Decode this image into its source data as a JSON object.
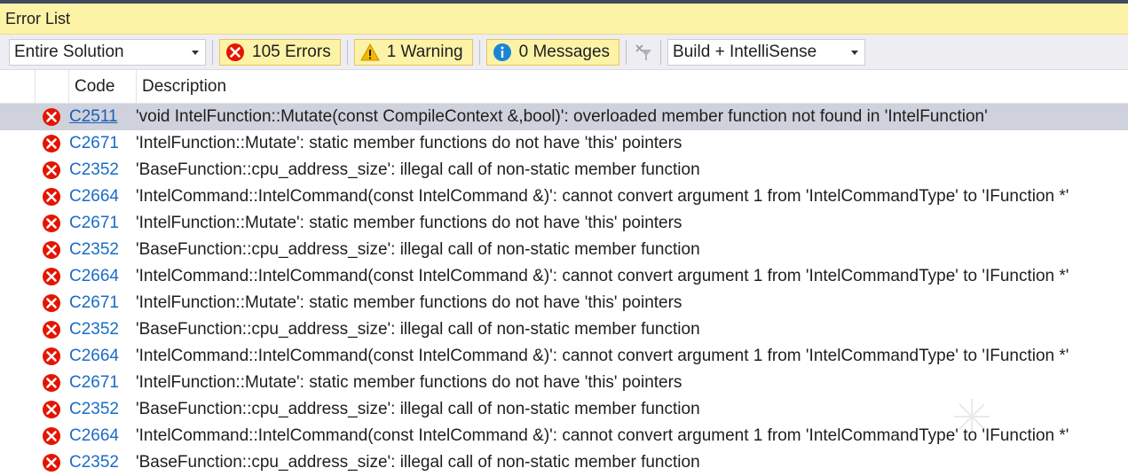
{
  "window": {
    "title": "Error List"
  },
  "toolbar": {
    "scope": "Entire Solution",
    "errors_label": "105 Errors",
    "warnings_label": "1 Warning",
    "messages_label": "0 Messages",
    "build_source": "Build + IntelliSense"
  },
  "columns": {
    "code": "Code",
    "description": "Description"
  },
  "rows": [
    {
      "code": "C2511",
      "description": "'void IntelFunction::Mutate(const CompileContext &,bool)': overloaded member function not found in 'IntelFunction'"
    },
    {
      "code": "C2671",
      "description": "'IntelFunction::Mutate': static member functions do not have 'this' pointers"
    },
    {
      "code": "C2352",
      "description": "'BaseFunction::cpu_address_size': illegal call of non-static member function"
    },
    {
      "code": "C2664",
      "description": "'IntelCommand::IntelCommand(const IntelCommand &)': cannot convert argument 1 from 'IntelCommandType' to 'IFunction *'"
    },
    {
      "code": "C2671",
      "description": "'IntelFunction::Mutate': static member functions do not have 'this' pointers"
    },
    {
      "code": "C2352",
      "description": "'BaseFunction::cpu_address_size': illegal call of non-static member function"
    },
    {
      "code": "C2664",
      "description": "'IntelCommand::IntelCommand(const IntelCommand &)': cannot convert argument 1 from 'IntelCommandType' to 'IFunction *'"
    },
    {
      "code": "C2671",
      "description": "'IntelFunction::Mutate': static member functions do not have 'this' pointers"
    },
    {
      "code": "C2352",
      "description": "'BaseFunction::cpu_address_size': illegal call of non-static member function"
    },
    {
      "code": "C2664",
      "description": "'IntelCommand::IntelCommand(const IntelCommand &)': cannot convert argument 1 from 'IntelCommandType' to 'IFunction *'"
    },
    {
      "code": "C2671",
      "description": "'IntelFunction::Mutate': static member functions do not have 'this' pointers"
    },
    {
      "code": "C2352",
      "description": "'BaseFunction::cpu_address_size': illegal call of non-static member function"
    },
    {
      "code": "C2664",
      "description": "'IntelCommand::IntelCommand(const IntelCommand &)': cannot convert argument 1 from 'IntelCommandType' to 'IFunction *'"
    },
    {
      "code": "C2352",
      "description": "'BaseFunction::cpu_address_size': illegal call of non-static member function"
    }
  ],
  "colors": {
    "error": "#e51400",
    "warning": "#f5b800",
    "info": "#1a85d6",
    "link": "#1a6cc6"
  }
}
